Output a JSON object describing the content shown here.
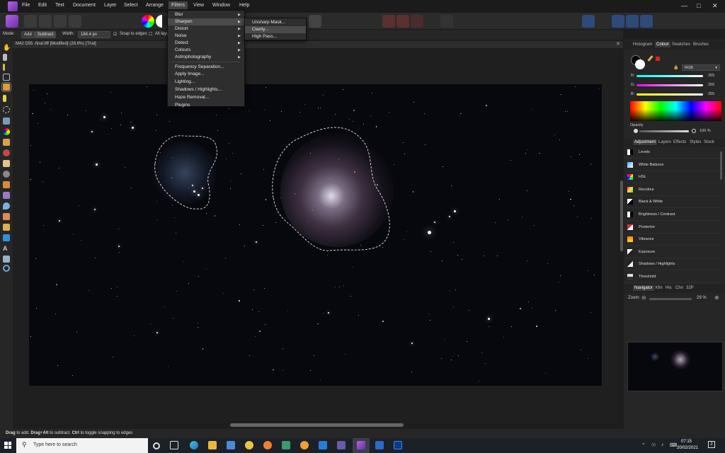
{
  "menubar": {
    "items": [
      "File",
      "Edit",
      "Text",
      "Document",
      "Layer",
      "Select",
      "Arrange",
      "Filters",
      "View",
      "Window",
      "Help"
    ]
  },
  "context_bar": {
    "mode_label": "Mode:",
    "add_label": "Add",
    "subtract_label": "Subtract",
    "width_label": "Width:",
    "width_value": "184.4 px",
    "snap_label": "Snap to edges",
    "all_layers_label": "All laye"
  },
  "document": {
    "title": "M42 D55 -final.tiff [Modified] (28.8%) [Trial]"
  },
  "filters_menu": {
    "items": [
      "Blur",
      "Sharpen",
      "Distort",
      "Noise",
      "Detect",
      "Colours",
      "Astrophotography",
      "Frequency Separation...",
      "Apply Image...",
      "Lighting...",
      "Shadows / Highlights...",
      "Haze Removal...",
      "Plugins"
    ],
    "highlighted": "Sharpen"
  },
  "sharpen_menu": {
    "items": [
      "Unsharp Mask...",
      "Clarity...",
      "High Pass..."
    ],
    "highlighted": "Clarity..."
  },
  "colour_panel": {
    "tabs": [
      "Histogram",
      "Colour",
      "Swatches",
      "Brushes"
    ],
    "active_tab": "Colour",
    "model": "RGB",
    "r_label": "R:",
    "r_value": "255",
    "g_label": "G:",
    "g_value": "255",
    "b_label": "B:",
    "b_value": "255",
    "opacity_label": "Opacity",
    "opacity_value": "100 %"
  },
  "adjustment_panel": {
    "tabs": [
      "Adjustment",
      "Layers",
      "Effects",
      "Styles",
      "Stock"
    ],
    "active_tab": "Adjustment",
    "items": [
      {
        "label": "Levels",
        "icon": "levels-icon"
      },
      {
        "label": "White Balance",
        "icon": "white-balance-icon"
      },
      {
        "label": "HSL",
        "icon": "hsl-icon"
      },
      {
        "label": "Recolour",
        "icon": "recolour-icon"
      },
      {
        "label": "Black & White",
        "icon": "black-white-icon"
      },
      {
        "label": "Brightness / Contrast",
        "icon": "brightness-contrast-icon"
      },
      {
        "label": "Posterise",
        "icon": "posterise-icon"
      },
      {
        "label": "Vibrance",
        "icon": "vibrance-icon"
      },
      {
        "label": "Exposure",
        "icon": "exposure-icon"
      },
      {
        "label": "Shadows / Highlights",
        "icon": "shadows-highlights-icon"
      },
      {
        "label": "Threshold",
        "icon": "threshold-icon"
      }
    ]
  },
  "navigator_panel": {
    "tabs": [
      "Navigator",
      "Xfm",
      "His",
      "Chn",
      "32P"
    ],
    "active_tab": "Navigator",
    "zoom_label": "Zoom:",
    "zoom_value": "29 %"
  },
  "status_bar": {
    "k1": "Drag",
    "t1": " to add. ",
    "k2": "Drag",
    "t2": "+",
    "k3": "Alt",
    "t3": " to subtract. ",
    "k4": "Ctrl",
    "t4": " to toggle snapping to edges"
  },
  "taskbar": {
    "search_placeholder": "Type here to search",
    "time": "07:15",
    "date": "20/02/2021",
    "notification_count": "2"
  },
  "colors": {
    "accent": "#7a3cc4",
    "panel": "#262626",
    "canvas": "#1f1f1f"
  }
}
